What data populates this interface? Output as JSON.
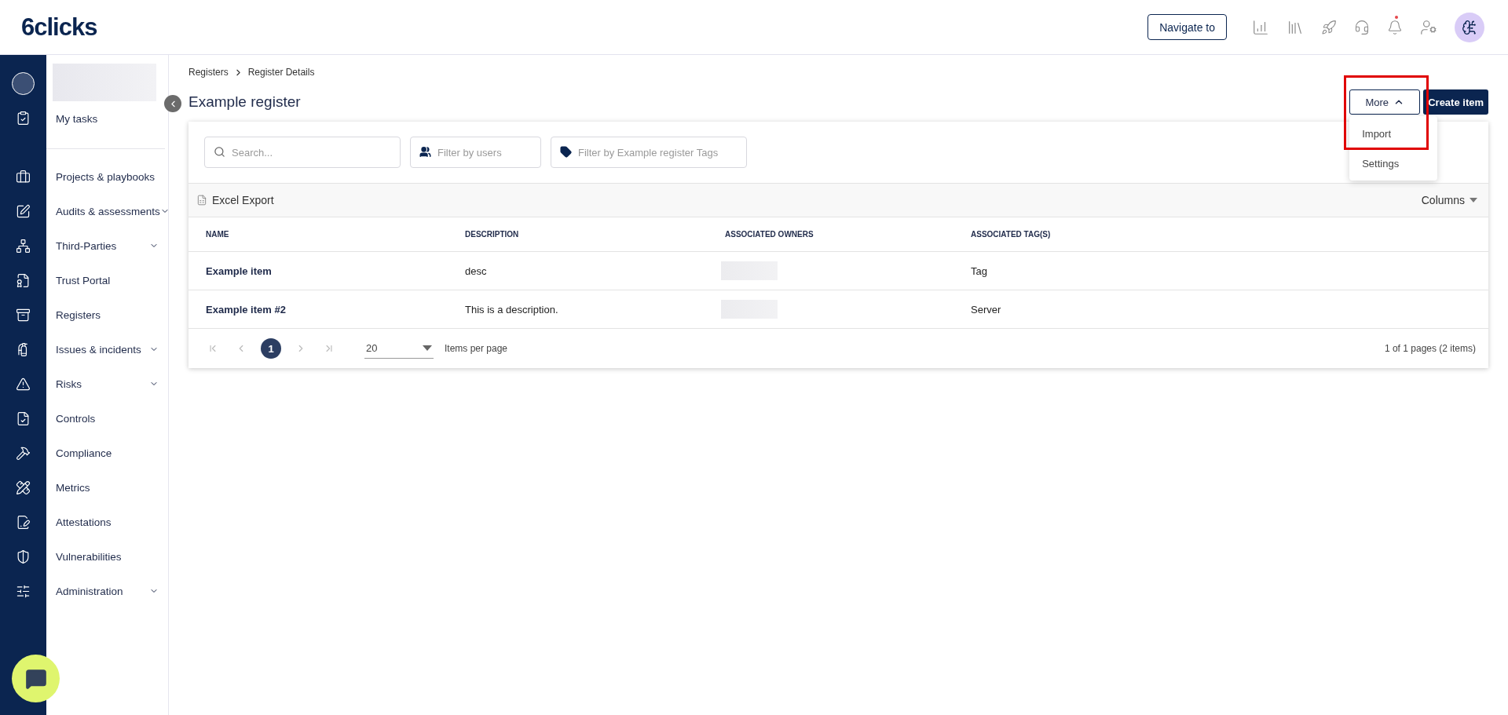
{
  "header": {
    "logo": "6clicks",
    "navigate_button": "Navigate to"
  },
  "sidebar": {
    "top_items": [
      {
        "label": "My tasks",
        "expandable": false
      }
    ],
    "items": [
      {
        "label": "Projects & playbooks",
        "expandable": false
      },
      {
        "label": "Audits & assessments",
        "expandable": true
      },
      {
        "label": "Third-Parties",
        "expandable": true
      },
      {
        "label": "Trust Portal",
        "expandable": false
      },
      {
        "label": "Registers",
        "expandable": false
      },
      {
        "label": "Issues & incidents",
        "expandable": true
      },
      {
        "label": "Risks",
        "expandable": true
      },
      {
        "label": "Controls",
        "expandable": false
      },
      {
        "label": "Compliance",
        "expandable": false
      },
      {
        "label": "Metrics",
        "expandable": false
      },
      {
        "label": "Attestations",
        "expandable": false
      },
      {
        "label": "Vulnerabilities",
        "expandable": false
      },
      {
        "label": "Administration",
        "expandable": true
      }
    ]
  },
  "breadcrumb": [
    "Registers",
    "Register Details"
  ],
  "title": "Example register",
  "actions": {
    "more": {
      "label": "More",
      "expanded": true
    },
    "create": "Create item"
  },
  "more_menu": [
    {
      "label": "Import"
    },
    {
      "label": "Settings"
    }
  ],
  "filters": [
    {
      "kind": "search",
      "placeholder": "Search..."
    },
    {
      "kind": "users",
      "placeholder": "Filter by users"
    },
    {
      "kind": "tags",
      "placeholder": "Filter by Example register Tags"
    }
  ],
  "toolbar": {
    "export": "Excel Export",
    "columns": "Columns"
  },
  "table": {
    "columns": [
      "NAME",
      "DESCRIPTION",
      "ASSOCIATED OWNERS",
      "ASSOCIATED TAG(S)"
    ],
    "rows": [
      {
        "name": "Example item",
        "description": "desc",
        "tag": "Tag"
      },
      {
        "name": "Example item #2",
        "description": "This is a description.",
        "tag": "Server"
      }
    ]
  },
  "pagination": {
    "pages": [
      {
        "label": "1",
        "selected": true
      }
    ],
    "page_size": "20",
    "page_size_label": "Items per page",
    "summary": "1 of 1 pages (2 items)"
  }
}
